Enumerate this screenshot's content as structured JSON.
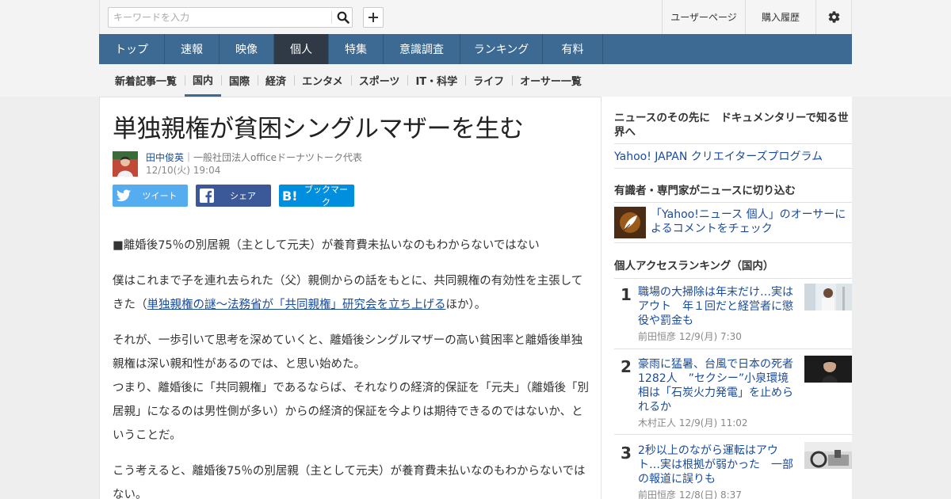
{
  "search": {
    "placeholder": "キーワードを入力"
  },
  "top_links": {
    "user_page": "ユーザーページ",
    "purchase_history": "購入履歴"
  },
  "main_nav": [
    "トップ",
    "速報",
    "映像",
    "個人",
    "特集",
    "意識調査",
    "ランキング",
    "有料"
  ],
  "main_nav_active": "個人",
  "sub_nav": [
    "新着記事一覧",
    "国内",
    "国際",
    "経済",
    "エンタメ",
    "スポーツ",
    "IT・科学",
    "ライフ",
    "オーサー一覧"
  ],
  "sub_nav_active": "国内",
  "article": {
    "title": "単独親権が貧困シングルマザーを生む",
    "author": "田中俊英",
    "author_role": "一般社団法人officeドーナツトーク代表",
    "date": "12/10(火) 19:04",
    "share": {
      "tweet": "ツイート",
      "share": "シェア",
      "bookmark": "ブックマーク"
    },
    "p1": "■離婚後75％の別居親（主として元夫）が養育費未払いなのもわからないではない",
    "p2_before": "僕はこれまで子を連れ去られた（父）親側からの話をもとに、共同親権の有効性を主張してきた（",
    "p2_link": "単独親権の謎～法務省が「共同親権」研究会を立ち上げる",
    "p2_after": "ほか）。",
    "p3a": "それが、一歩引いて思考を深めていくと、離婚後シングルマザーの高い貧困率と離婚後単独親権は深い親和性があるのでは、と思い始めた。",
    "p3b": "つまり、離婚後に「共同親権」であるならば、それなりの経済的保証を「元夫」（離婚後「別居親」になるのは男性側が多い）からの経済的保証を今よりは期待できるのではないか、ということだ。",
    "p4": "こう考えると、離婚後75％の別居親（主として元夫）が養育費未払いなのもわからないではない。"
  },
  "sidebar": {
    "doc_heading": "ニュースのその先に　ドキュメンタリーで知る世界へ",
    "creators_link": "Yahoo! JAPAN クリエイターズプログラム",
    "experts_heading": "有識者・専門家がニュースに切り込む",
    "owner_comment": "「Yahoo!ニュース 個人」のオーサーによるコメントをチェック",
    "ranking_heading": "個人アクセスランキング（国内）",
    "ranking": [
      {
        "rank": "1",
        "title": "職場の大掃除は年末だけ…実はアウト　年１回だと経営者に懲役や罰金も",
        "author": "前田恒彦",
        "date": "12/9(月) 7:30"
      },
      {
        "rank": "2",
        "title": "豪雨に猛暑、台風で日本の死者1282人　”セクシー”小泉環境相は「石炭火力発電」を止められるか",
        "author": "木村正人",
        "date": "12/9(月) 11:02"
      },
      {
        "rank": "3",
        "title": "2秒以上のながら運転はアウト…実は根拠が弱かった　一部の報道に誤りも",
        "author": "前田恒彦",
        "date": "12/8(日) 8:37"
      }
    ]
  }
}
